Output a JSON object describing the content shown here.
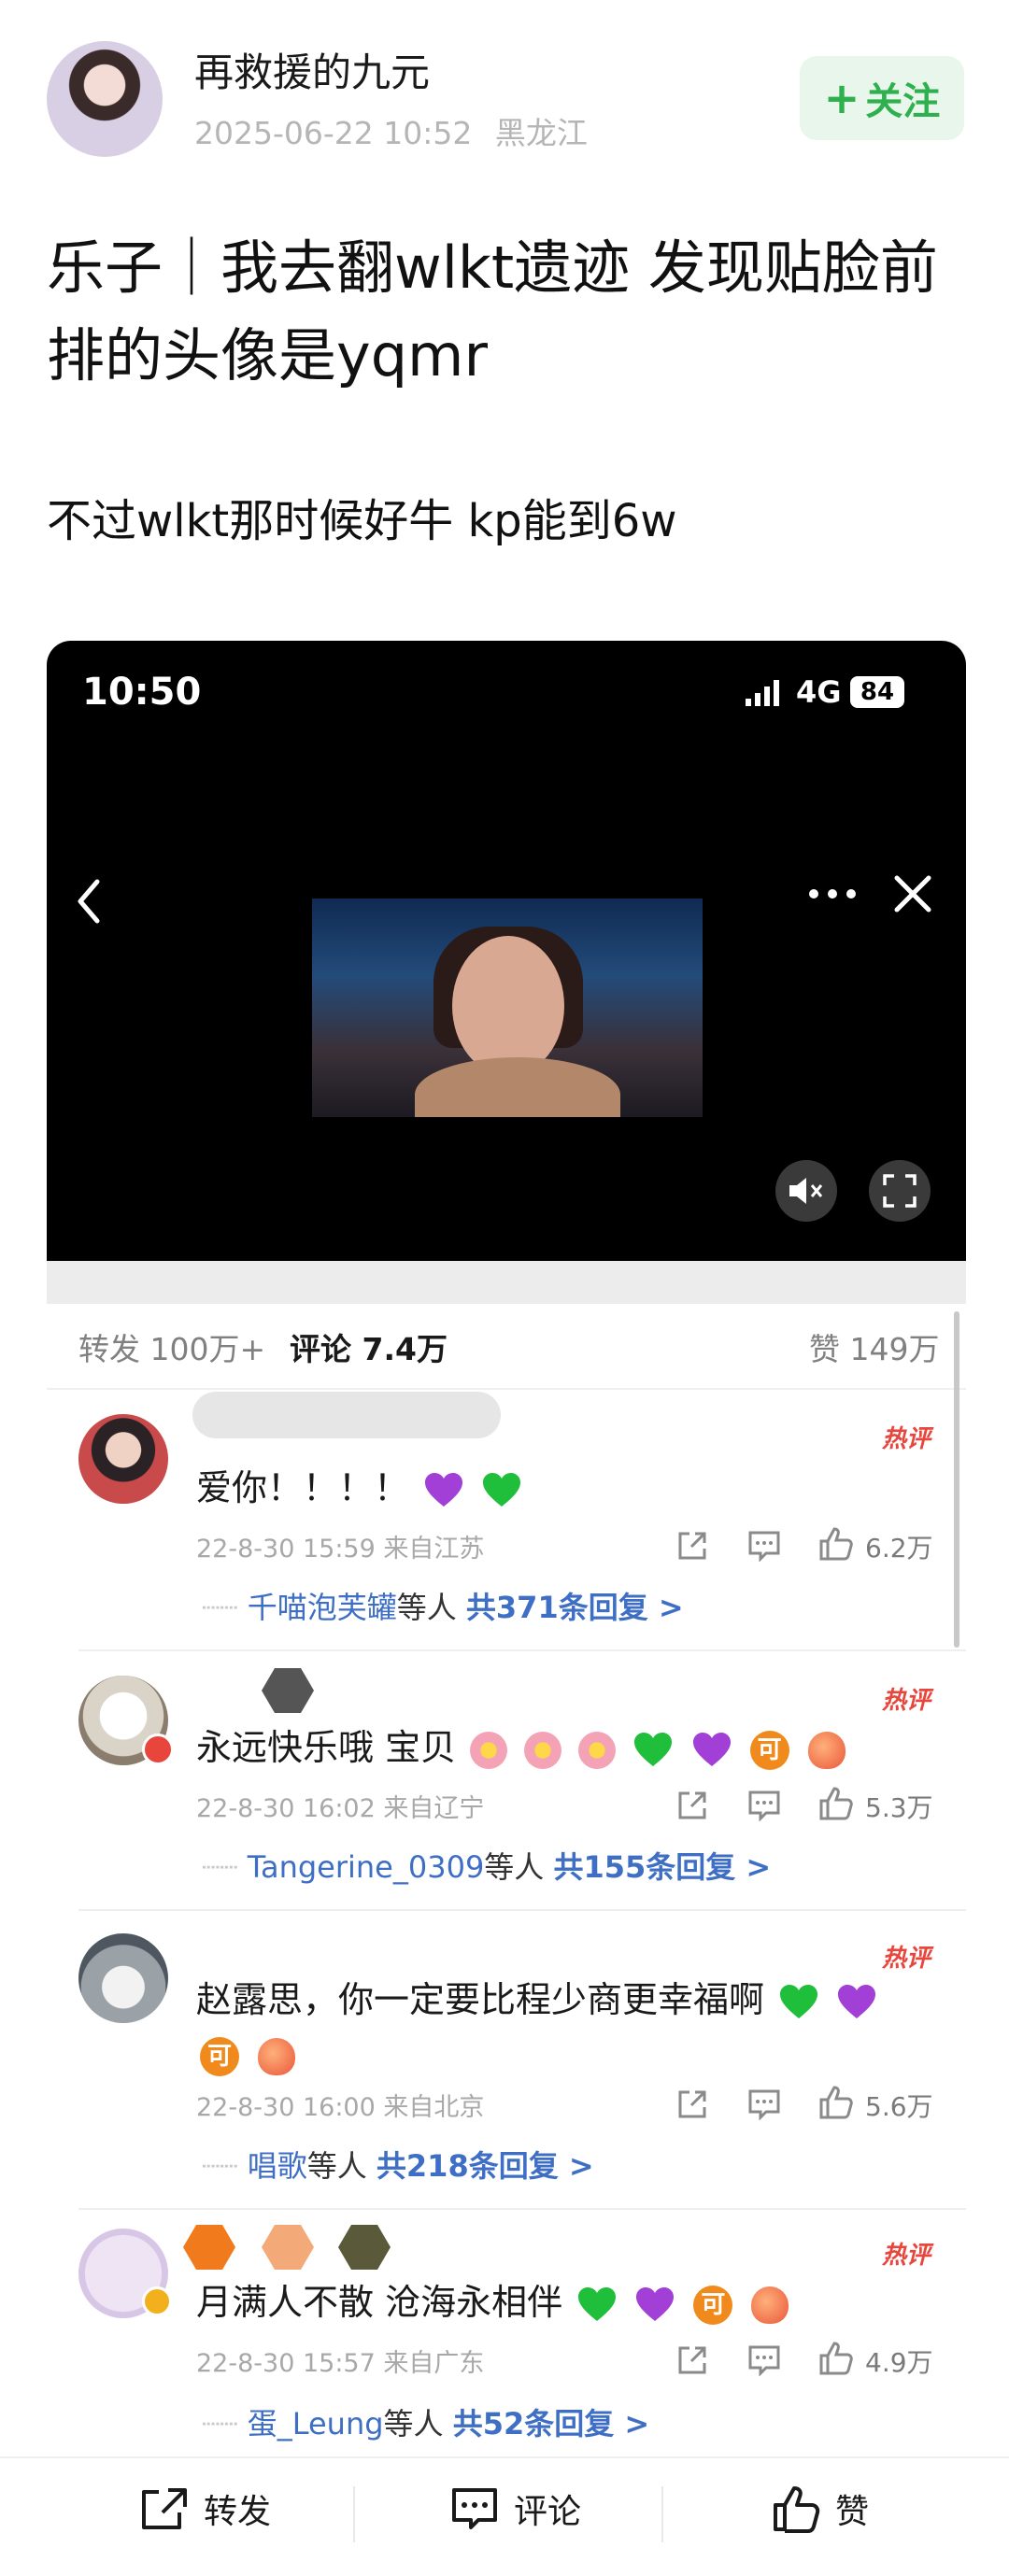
{
  "post": {
    "username": "再救援的九元",
    "timestamp": "2025-06-22 10:52",
    "location": "黑龙江",
    "follow_label": "关注",
    "title": "乐子｜我去翻wlkt遗迹 发现贴脸前排的头像是yqmr",
    "subtitle": "不过wlkt那时候好牛 kp能到6w"
  },
  "video": {
    "time": "10:50",
    "network": "4G",
    "battery": "84"
  },
  "stats": {
    "repost": "转发 100万+",
    "comments": "评论 7.4万",
    "likes": "赞 149万"
  },
  "comments": [
    {
      "hot_label": "热评",
      "text": "爱你！！！！",
      "date": "22-8-30 15:59",
      "location": "来自江苏",
      "likes": "6.2万",
      "reply_user": "千喵泡芙罐",
      "reply_suffix": "等人",
      "reply_count": "共371条回复 >"
    },
    {
      "hot_label": "热评",
      "text": "永远快乐哦 宝贝",
      "date": "22-8-30 16:02",
      "location": "来自辽宁",
      "likes": "5.3万",
      "reply_user": "Tangerine_0309",
      "reply_suffix": "等人",
      "reply_count": "共155条回复 >"
    },
    {
      "hot_label": "热评",
      "text": "赵露思，你一定要比程少商更幸福啊",
      "date": "22-8-30 16:00",
      "location": "来自北京",
      "likes": "5.6万",
      "reply_user": "唱歌",
      "reply_suffix": "等人",
      "reply_count": "共218条回复 >"
    },
    {
      "hot_label": "热评",
      "text": "月满人不散 沧海永相伴",
      "date": "22-8-30 15:57",
      "location": "来自广东",
      "likes": "4.9万",
      "reply_user": "蛋_Leung",
      "reply_suffix": "等人",
      "reply_count": "共52条回复 >"
    }
  ],
  "bottom_bar": {
    "repost": "转发",
    "comment": "评论",
    "like": "赞"
  },
  "colors": {
    "follow_green": "#2fb04f",
    "hot_red": "#e8463c",
    "link_blue": "#3f6fc4"
  }
}
